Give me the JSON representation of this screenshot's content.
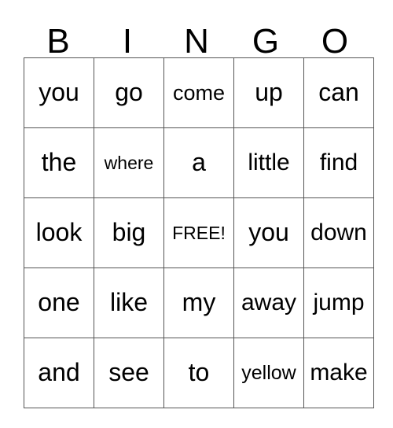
{
  "card": {
    "title": "BINGO",
    "header": {
      "letters": [
        "B",
        "I",
        "N",
        "G",
        "O"
      ]
    },
    "colors": {
      "background": "#ffffff",
      "text": "#000000",
      "gridline": "#555555"
    },
    "grid": {
      "rows": 5,
      "columns": 5,
      "free_space": {
        "row": 3,
        "column": 3,
        "label": "FREE!"
      },
      "cells": [
        [
          {
            "text": "you",
            "size": "fs-xl"
          },
          {
            "text": "go",
            "size": "fs-xl"
          },
          {
            "text": "come",
            "size": "fs-md"
          },
          {
            "text": "up",
            "size": "fs-xl"
          },
          {
            "text": "can",
            "size": "fs-xl"
          }
        ],
        [
          {
            "text": "the",
            "size": "fs-xl"
          },
          {
            "text": "where",
            "size": "fs-xs"
          },
          {
            "text": "a",
            "size": "fs-xl"
          },
          {
            "text": "little",
            "size": "fs-lg"
          },
          {
            "text": "find",
            "size": "fs-lg"
          }
        ],
        [
          {
            "text": "look",
            "size": "fs-xl"
          },
          {
            "text": "big",
            "size": "fs-xl"
          },
          {
            "text": "FREE!",
            "size": "fs-xs"
          },
          {
            "text": "you",
            "size": "fs-xl"
          },
          {
            "text": "down",
            "size": "fs-lg"
          }
        ],
        [
          {
            "text": "one",
            "size": "fs-xl"
          },
          {
            "text": "like",
            "size": "fs-xl"
          },
          {
            "text": "my",
            "size": "fs-xl"
          },
          {
            "text": "away",
            "size": "fs-lg"
          },
          {
            "text": "jump",
            "size": "fs-lg"
          }
        ],
        [
          {
            "text": "and",
            "size": "fs-xl"
          },
          {
            "text": "see",
            "size": "fs-xl"
          },
          {
            "text": "to",
            "size": "fs-xl"
          },
          {
            "text": "yellow",
            "size": "fs-sm"
          },
          {
            "text": "make",
            "size": "fs-lg"
          }
        ]
      ]
    }
  }
}
